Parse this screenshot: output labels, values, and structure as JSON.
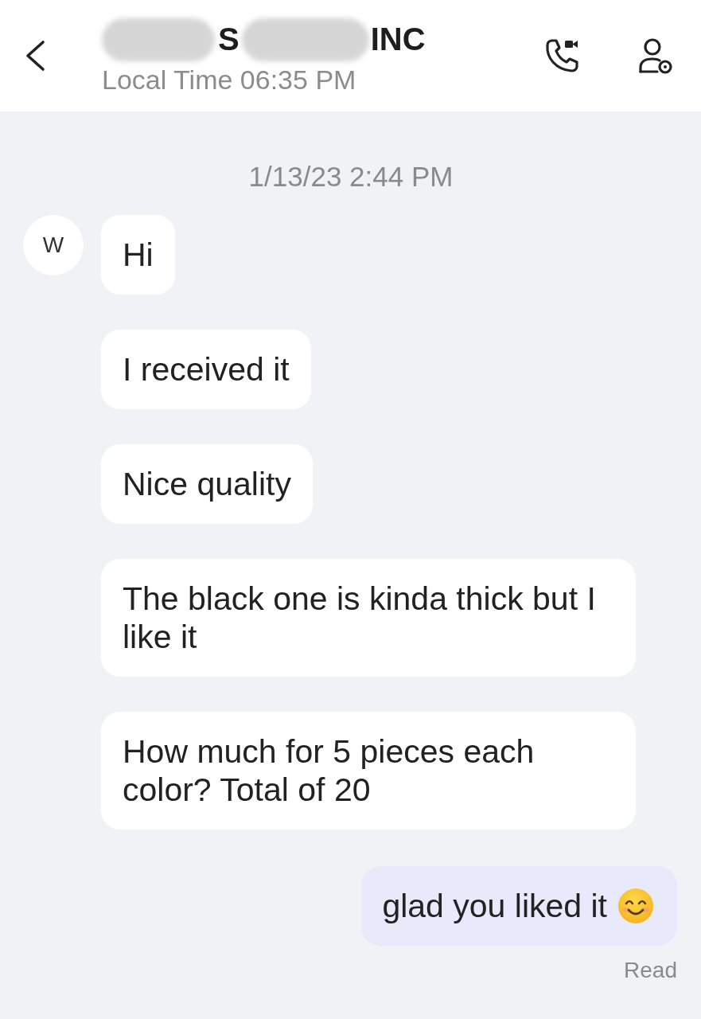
{
  "header": {
    "title_fragments": [
      "S",
      "INC"
    ],
    "subtitle": "Local Time 06:35 PM"
  },
  "conversation": {
    "timestamp": "1/13/23 2:44 PM",
    "messages": [
      {
        "kind": "incoming",
        "avatar": "W",
        "text": "Hi"
      },
      {
        "kind": "incoming",
        "text": "I received it"
      },
      {
        "kind": "incoming",
        "text": "Nice quality"
      },
      {
        "kind": "incoming",
        "text": "The black one is kinda thick but I like it"
      },
      {
        "kind": "incoming",
        "text": "How much for 5 pieces each color? Total of 20"
      },
      {
        "kind": "outgoing",
        "text": "glad you liked it",
        "trailing_emoji": true,
        "receipt": "Read"
      }
    ]
  }
}
